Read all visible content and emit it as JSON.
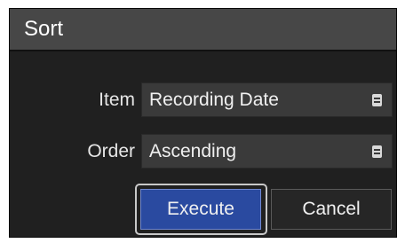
{
  "dialog": {
    "title": "Sort",
    "item": {
      "label": "Item",
      "value": "Recording Date",
      "icon": "list-icon"
    },
    "order": {
      "label": "Order",
      "value": "Ascending",
      "icon": "list-icon"
    },
    "buttons": {
      "execute": "Execute",
      "cancel": "Cancel"
    }
  },
  "colors": {
    "background": "#202020",
    "titlebar": "#474747",
    "select_bg": "#3a3a3a",
    "primary_button": "#2a4aa0",
    "secondary_button": "#262626"
  }
}
